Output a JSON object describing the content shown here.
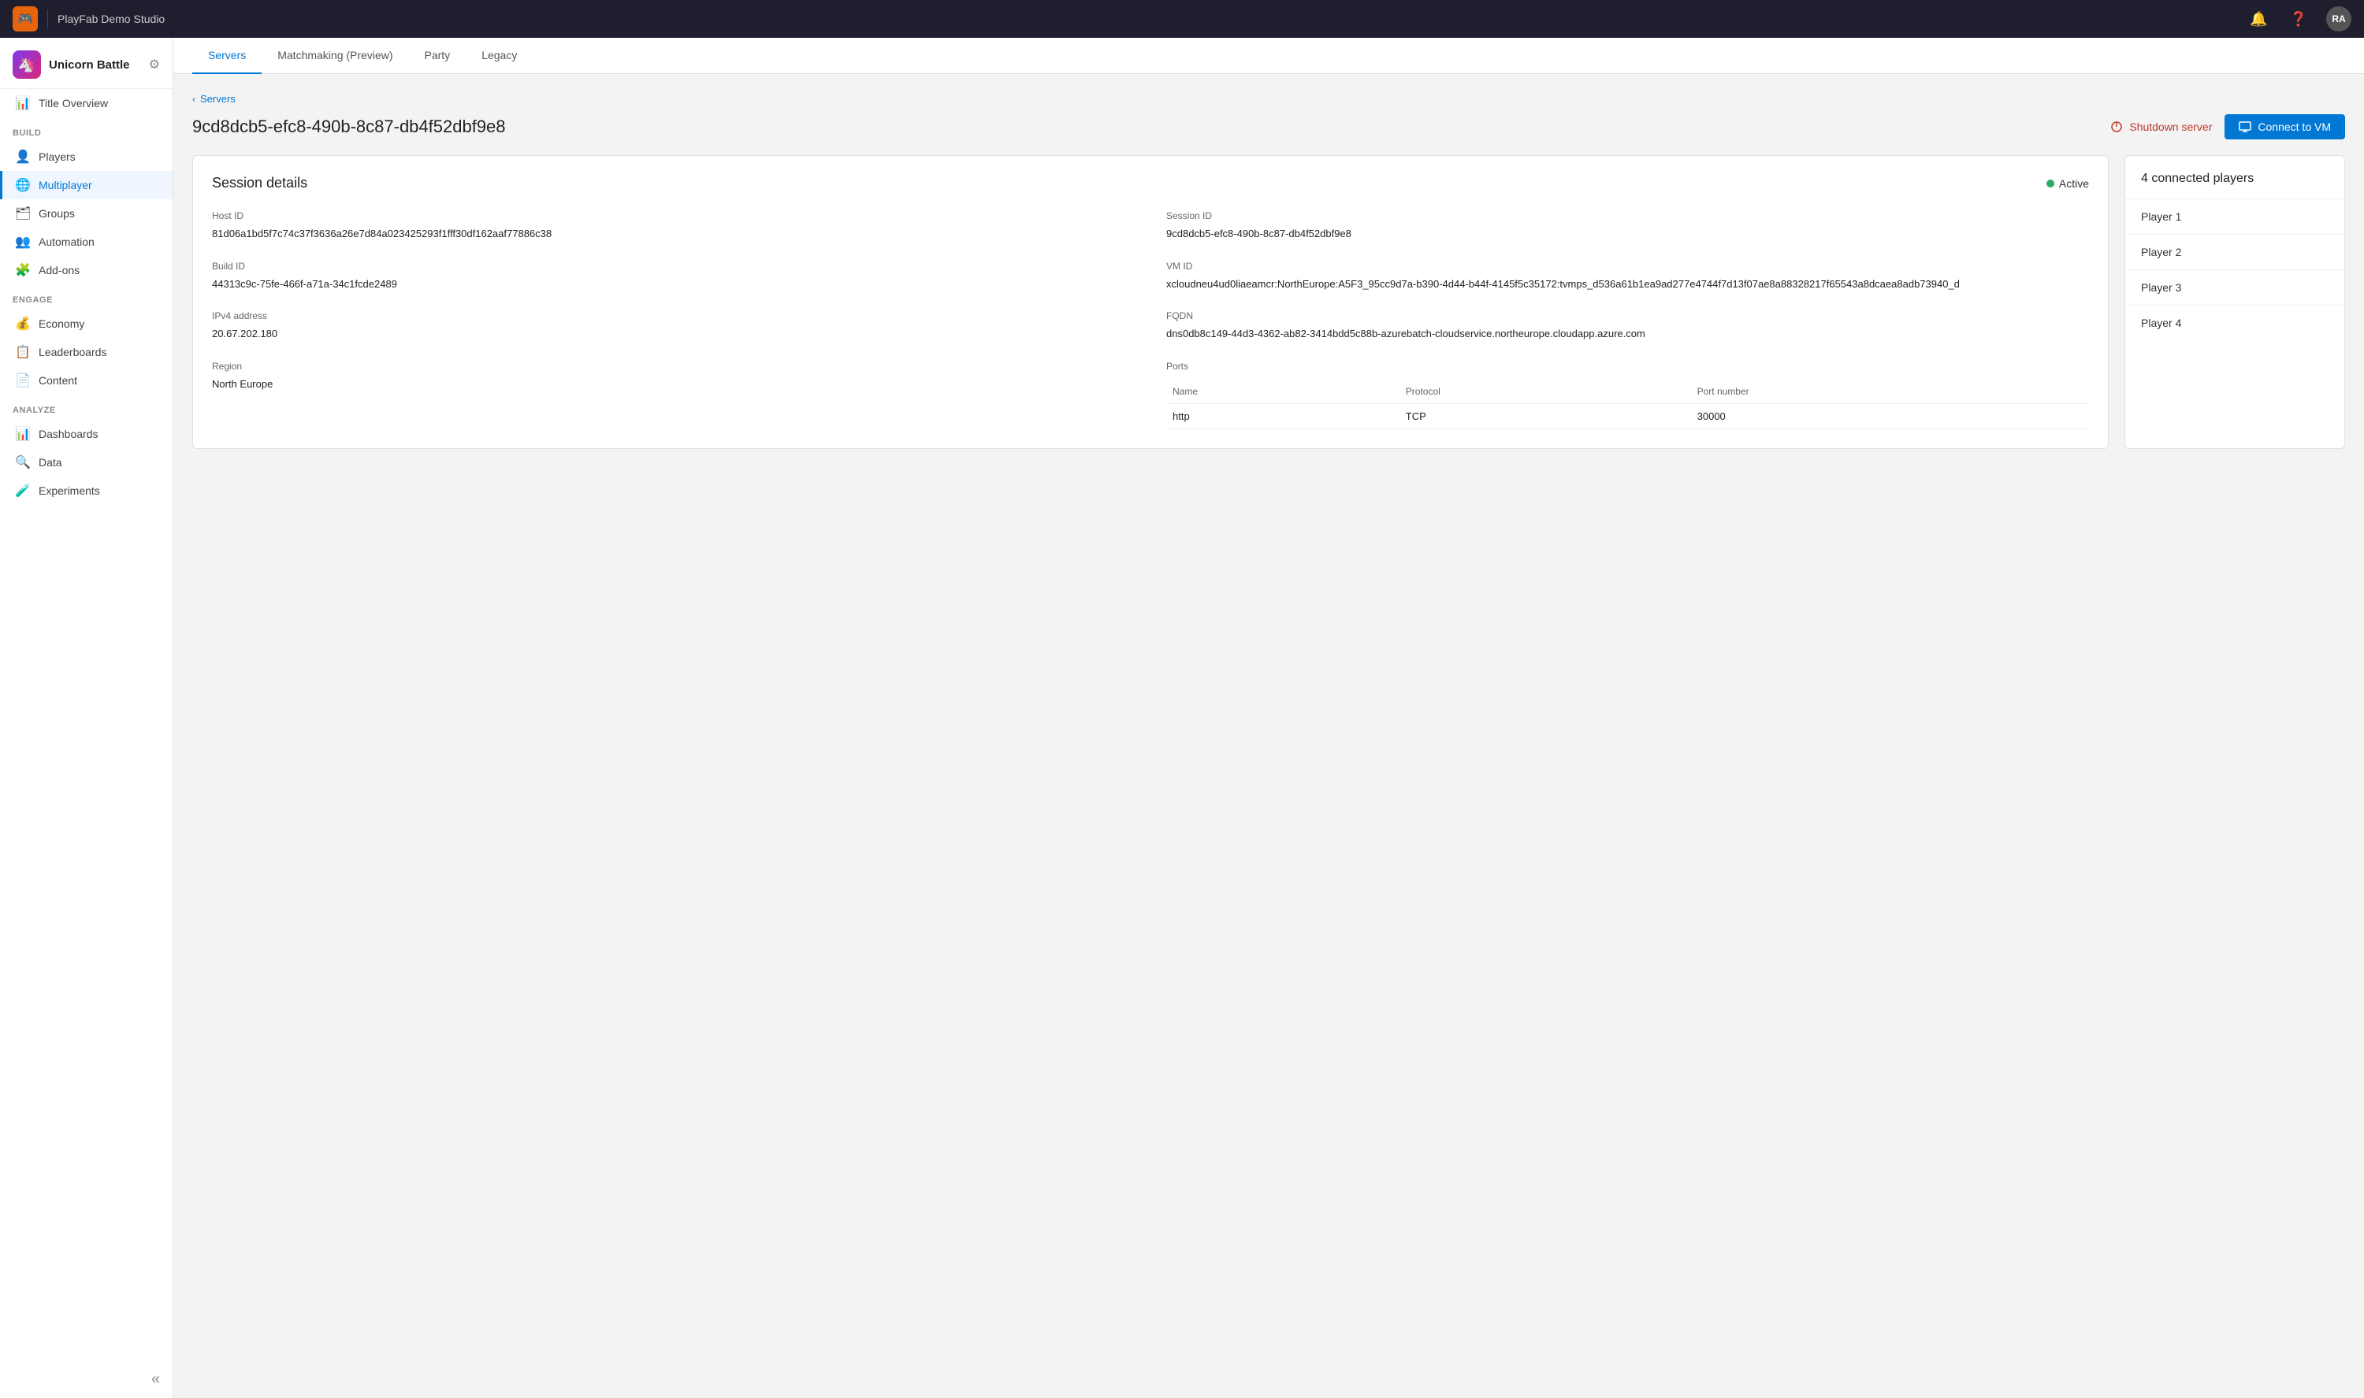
{
  "app": {
    "title": "PlayFab Demo Studio",
    "avatar_initials": "RA"
  },
  "sidebar": {
    "project_name": "Unicorn Battle",
    "settings_icon": "⚙",
    "collapse_icon": "«",
    "sections": [
      {
        "label": "",
        "items": [
          {
            "id": "title-overview",
            "label": "Title Overview",
            "icon": "📊"
          }
        ]
      },
      {
        "label": "BUILD",
        "items": [
          {
            "id": "players",
            "label": "Players",
            "icon": "👤"
          },
          {
            "id": "multiplayer",
            "label": "Multiplayer",
            "icon": "🌐",
            "active": true
          },
          {
            "id": "groups",
            "label": "Groups",
            "icon": "🗂"
          },
          {
            "id": "automation",
            "label": "Automation",
            "icon": "👥"
          },
          {
            "id": "add-ons",
            "label": "Add-ons",
            "icon": "🧩"
          }
        ]
      },
      {
        "label": "ENGAGE",
        "items": [
          {
            "id": "economy",
            "label": "Economy",
            "icon": "💰"
          },
          {
            "id": "leaderboards",
            "label": "Leaderboards",
            "icon": "📋"
          },
          {
            "id": "content",
            "label": "Content",
            "icon": "📄"
          }
        ]
      },
      {
        "label": "ANALYZE",
        "items": [
          {
            "id": "dashboards",
            "label": "Dashboards",
            "icon": "📊"
          },
          {
            "id": "data",
            "label": "Data",
            "icon": "🔍"
          },
          {
            "id": "experiments",
            "label": "Experiments",
            "icon": "🧪"
          }
        ]
      }
    ]
  },
  "tabs": [
    {
      "id": "servers",
      "label": "Servers",
      "active": true
    },
    {
      "id": "matchmaking",
      "label": "Matchmaking (Preview)"
    },
    {
      "id": "party",
      "label": "Party"
    },
    {
      "id": "legacy",
      "label": "Legacy"
    }
  ],
  "breadcrumb": {
    "label": "Servers"
  },
  "page": {
    "title": "9cd8dcb5-efc8-490b-8c87-db4f52dbf9e8",
    "shutdown_label": "Shutdown server",
    "connect_label": "Connect to VM"
  },
  "session": {
    "title": "Session details",
    "status": "Active",
    "fields": {
      "host_id_label": "Host ID",
      "host_id_value": "81d06a1bd5f7c74c37f3636a26e7d84a023425293f1fff30df162aaf77886c38",
      "session_id_label": "Session ID",
      "session_id_value": "9cd8dcb5-efc8-490b-8c87-db4f52dbf9e8",
      "build_id_label": "Build ID",
      "build_id_value": "44313c9c-75fe-466f-a71a-34c1fcde2489",
      "vm_id_label": "VM ID",
      "vm_id_value": "xcloudneu4ud0liaeamcr:NorthEurope:A5F3_95cc9d7a-b390-4d44-b44f-4145f5c35172:tvmps_d536a61b1ea9ad277e4744f7d13f07ae8a88328217f65543a8dcaea8adb73940_d",
      "ipv4_label": "IPv4 address",
      "ipv4_value": "20.67.202.180",
      "fqdn_label": "FQDN",
      "fqdn_value": "dns0db8c149-44d3-4362-ab82-3414bdd5c88b-azurebatch-cloudservice.northeurope.cloudapp.azure.com",
      "region_label": "Region",
      "region_value": "North Europe",
      "ports_label": "Ports"
    },
    "ports_table": {
      "headers": [
        "Name",
        "Protocol",
        "Port number"
      ],
      "rows": [
        {
          "name": "http",
          "protocol": "TCP",
          "port": "30000"
        }
      ]
    }
  },
  "players_panel": {
    "title": "4 connected players",
    "players": [
      {
        "label": "Player 1"
      },
      {
        "label": "Player 2"
      },
      {
        "label": "Player 3"
      },
      {
        "label": "Player 4"
      }
    ]
  }
}
